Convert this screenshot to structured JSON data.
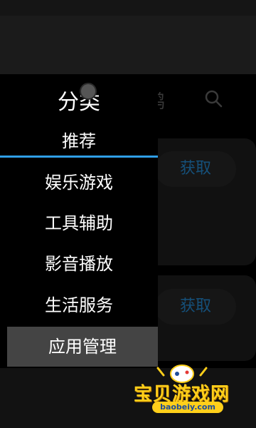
{
  "drawer": {
    "title": "分类",
    "items": [
      {
        "label": "推荐",
        "state": "active"
      },
      {
        "label": "娱乐游戏",
        "state": "normal"
      },
      {
        "label": "工具辅助",
        "state": "normal"
      },
      {
        "label": "影音播放",
        "state": "normal"
      },
      {
        "label": "生活服务",
        "state": "normal"
      },
      {
        "label": "应用管理",
        "state": "selected"
      }
    ]
  },
  "background": {
    "tab_text": "鸬",
    "get_buttons": [
      "获取",
      "获取"
    ]
  },
  "watermark": {
    "name": "宝贝游戏网",
    "url": "baobeiy.com"
  },
  "colors": {
    "accent": "#2f9ee6",
    "selected_bg": "#444444",
    "button_text": "#15507a",
    "watermark_yellow": "#ffcf1a"
  }
}
